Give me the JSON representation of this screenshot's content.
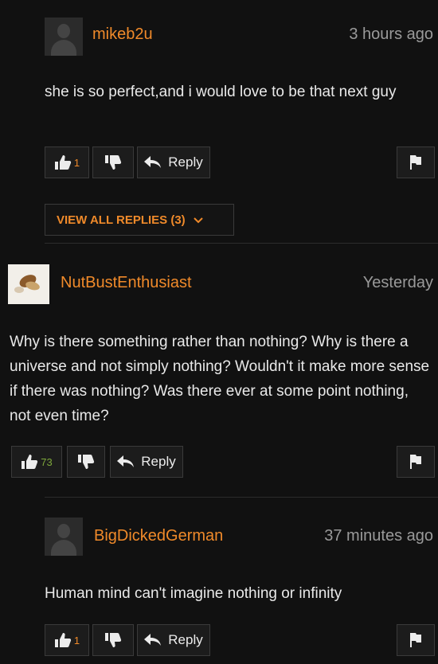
{
  "comments": [
    {
      "username": "mikeb2u",
      "timestamp": "3 hours ago",
      "text": "she is so perfect,and i would love to be that next guy",
      "likes": "1",
      "reply_label": "Reply",
      "view_replies_label": "VIEW ALL REPLIES (3)"
    },
    {
      "username": "NutBustEnthusiast",
      "timestamp": "Yesterday",
      "text": "Why is there something rather than nothing? Why is there a universe and not simply nothing? Wouldn't it make more sense if there was nothing? Was there ever at some point nothing, not even time?",
      "likes": "73",
      "reply_label": "Reply"
    },
    {
      "username": "BigDickedGerman",
      "timestamp": "37 minutes ago",
      "text": "Human mind can't imagine nothing or infinity",
      "likes": "1",
      "reply_label": "Reply"
    }
  ],
  "colors": {
    "background": "#111111",
    "username": "#f08a2a",
    "timestamp": "#9a9a9a",
    "like_count_green": "#7ea83b"
  },
  "icons": [
    "default-avatar-icon",
    "thumbs-up-icon",
    "thumbs-down-icon",
    "reply-arrow-icon",
    "flag-icon",
    "chevron-down-icon"
  ]
}
